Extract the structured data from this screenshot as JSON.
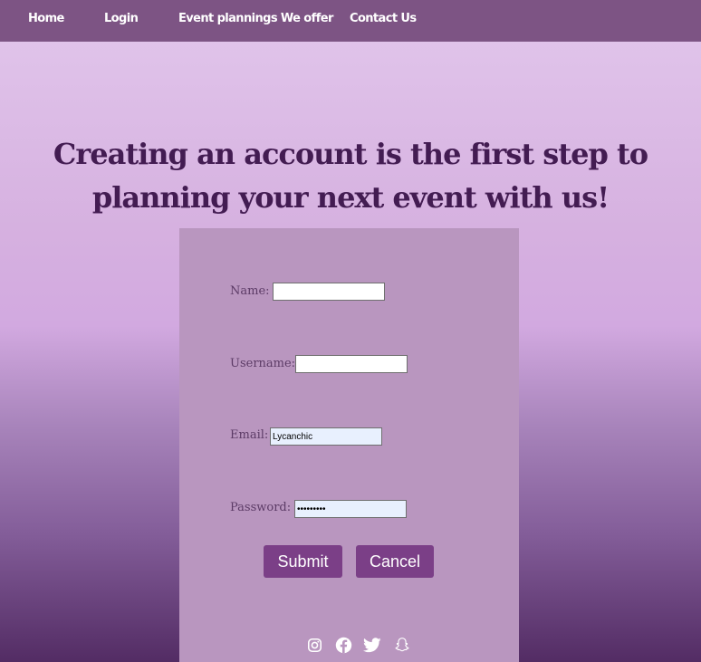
{
  "nav": {
    "items": [
      {
        "label": "Home"
      },
      {
        "label": "Login"
      },
      {
        "label": "Event plannings We offer"
      },
      {
        "label": "Contact Us"
      }
    ]
  },
  "headline": "Creating an account is the first step to planning your next event with us!",
  "form": {
    "name_label": "Name:",
    "name_value": "",
    "username_label": "Username:",
    "username_value": "",
    "email_label": "Email:",
    "email_value": "Lycanchic",
    "password_label": "Password:",
    "password_value": "•••••••••"
  },
  "buttons": {
    "submit_label": "Submit",
    "cancel_label": "Cancel"
  },
  "social": [
    "instagram-icon",
    "facebook-icon",
    "twitter-icon",
    "snapchat-icon"
  ],
  "colors": {
    "navbar": "#7d5484",
    "panel": "#b996bf",
    "button": "#7b3f87",
    "headline": "#431c52"
  }
}
